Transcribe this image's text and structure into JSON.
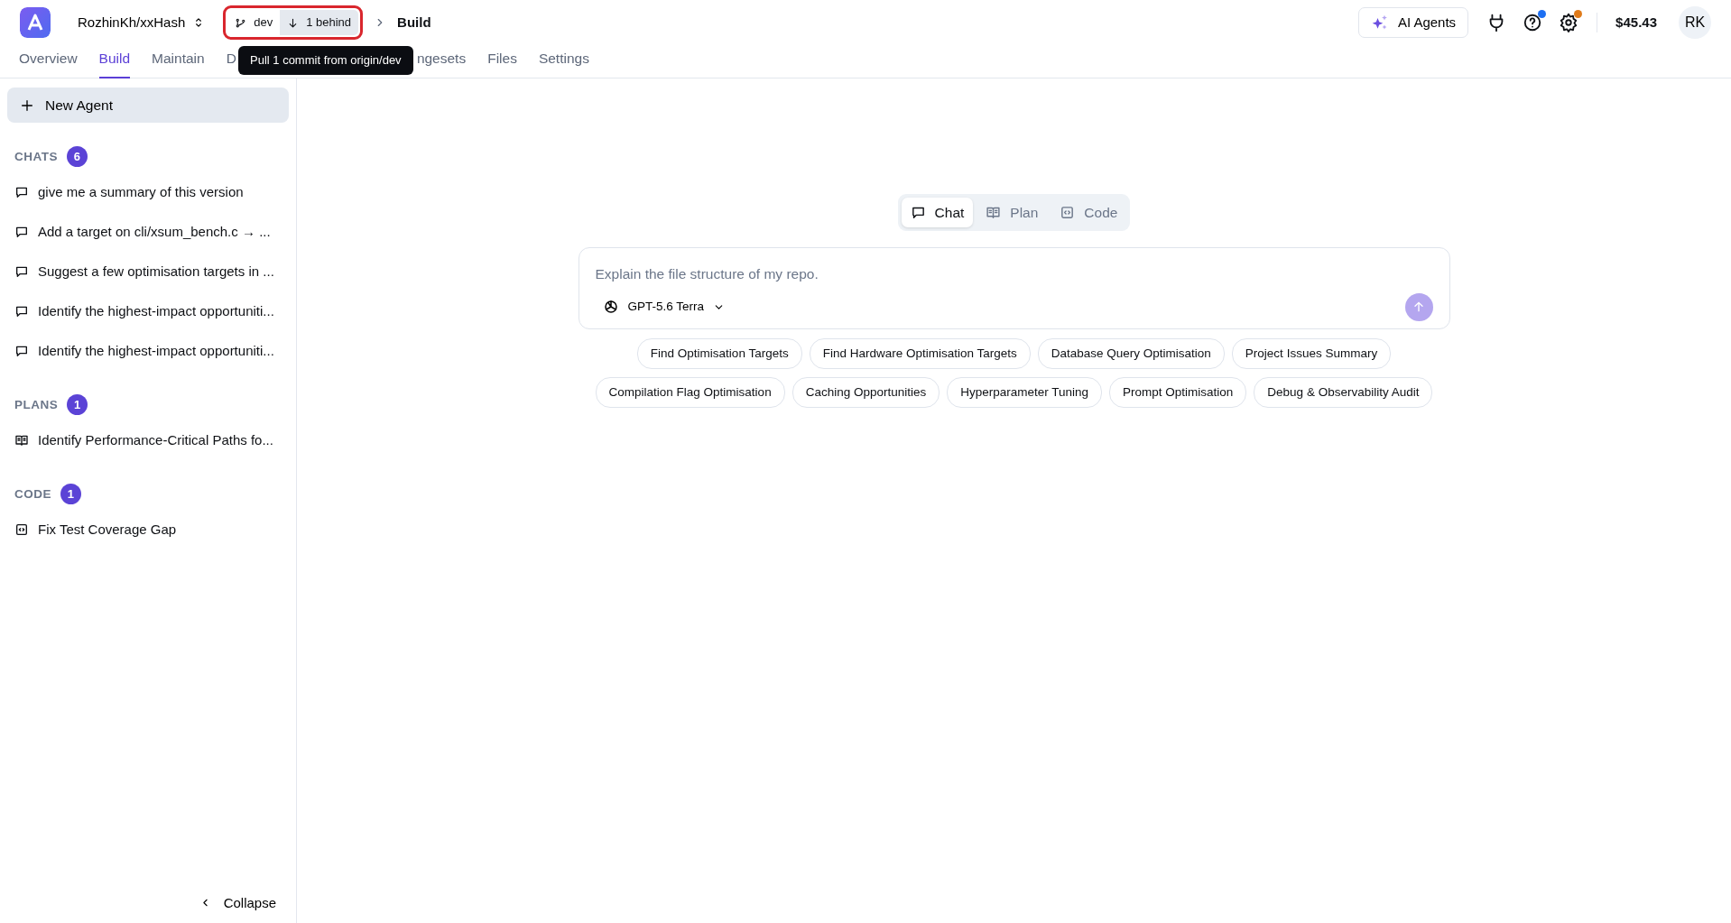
{
  "header": {
    "repo": "RozhinKh/xxHash",
    "branch": "dev",
    "sync_status": "1 behind",
    "breadcrumb": "Build",
    "ai_agents": "AI Agents",
    "balance": "$45.43",
    "avatar": "RK",
    "badges": [
      {
        "color": "#1d6ff2"
      },
      {
        "color": "#e07b1a"
      }
    ]
  },
  "tabs": [
    {
      "label": "Overview",
      "selected": false
    },
    {
      "label": "Build",
      "selected": true
    },
    {
      "label": "Maintain",
      "selected": false
    },
    {
      "label": "D",
      "selected": false
    },
    {
      "label": "ngesets",
      "selected": false
    },
    {
      "label": "Files",
      "selected": false
    },
    {
      "label": "Settings",
      "selected": false
    }
  ],
  "tooltip": "Pull 1 commit from origin/dev",
  "sidebar": {
    "new_agent": "New Agent",
    "sections": [
      {
        "title": "CHATS",
        "count": "6",
        "kind": "chat",
        "items": [
          "give me a summary of this version",
          "Add a target on cli/xsum_bench.c → ...",
          "Suggest a few optimisation targets in ...",
          "Identify the highest-impact opportuniti...",
          "Identify the highest-impact opportuniti..."
        ]
      },
      {
        "title": "PLANS",
        "count": "1",
        "kind": "plan",
        "items": [
          "Identify Performance-Critical Paths fo..."
        ]
      },
      {
        "title": "CODE",
        "count": "1",
        "kind": "code",
        "items": [
          "Fix Test Coverage Gap"
        ]
      }
    ],
    "collapse": "Collapse"
  },
  "modes": [
    {
      "label": "Chat",
      "kind": "chat",
      "selected": true
    },
    {
      "label": "Plan",
      "kind": "plan",
      "selected": false
    },
    {
      "label": "Code",
      "kind": "code",
      "selected": false
    }
  ],
  "composer": {
    "placeholder": "Explain the file structure of my repo.",
    "model": "GPT-5.6 Terra"
  },
  "suggestions": [
    [
      "Find Optimisation Targets",
      "Find Hardware Optimisation Targets",
      "Database Query Optimisation",
      "Project Issues Summary"
    ],
    [
      "Compilation Flag Optimisation",
      "Caching Opportunities",
      "Hyperparameter Tuning",
      "Prompt Optimisation",
      "Debug & Observability Audit"
    ]
  ]
}
